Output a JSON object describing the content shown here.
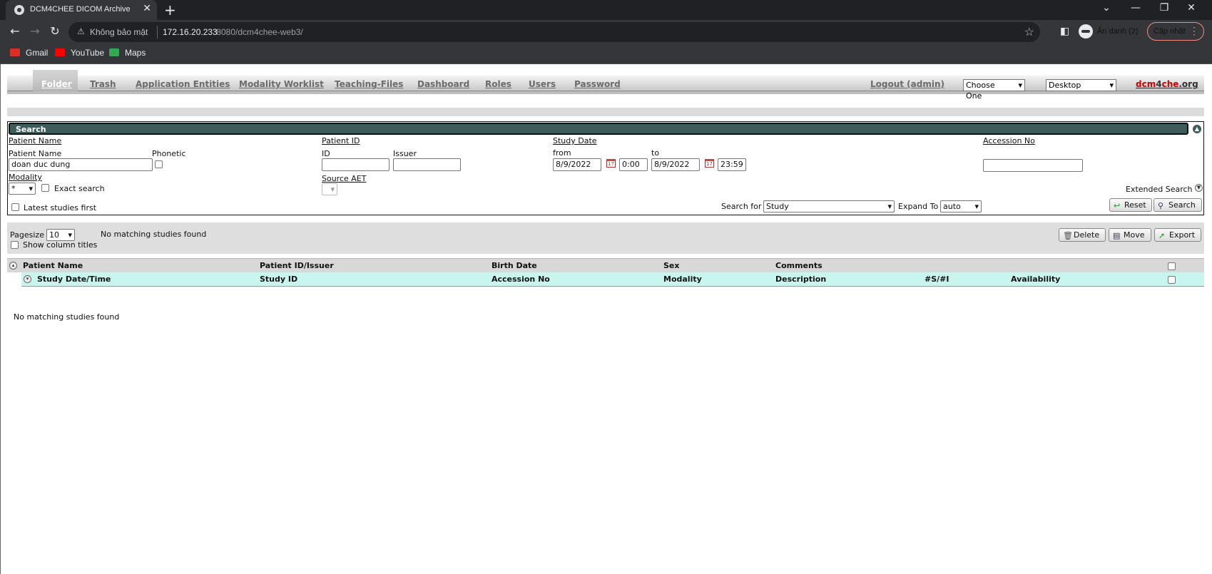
{
  "browser": {
    "tab_title": "DCM4CHEE DICOM Archive",
    "tab_close": "✕",
    "new_tab": "+",
    "window_controls": [
      "⌄",
      "—",
      "❐",
      "✕"
    ],
    "security_label": "Không bảo mật",
    "url_host": "172.16.20.233",
    "url_path": ":8080/dcm4chee-web3/",
    "incognito_label": "Ẩn danh (2)",
    "update_label": "Cập nhật",
    "bookmarks": [
      {
        "label": "Gmail",
        "color": "#d93025"
      },
      {
        "label": "YouTube",
        "color": "#ff0000"
      },
      {
        "label": "Maps",
        "color": "#34a853"
      }
    ]
  },
  "nav": {
    "items": [
      "Folder",
      "Trash",
      "Application Entities",
      "Modality Worklist",
      "Teaching-Files",
      "Dashboard",
      "Roles",
      "Users",
      "Password"
    ],
    "active": "Folder",
    "logout": "Logout (admin)",
    "choose_one": "Choose One",
    "desktop": "Desktop",
    "logo_parts": [
      "dcm",
      "4",
      "che",
      ".org"
    ]
  },
  "search": {
    "header": "Search",
    "patient_name_group": "Patient Name",
    "patient_name_label": "Patient Name",
    "patient_name_value": "doan duc dung",
    "phonetic_label": "Phonetic",
    "patient_id_group": "Patient ID",
    "id_label": "ID",
    "issuer_label": "Issuer",
    "study_date_group": "Study Date",
    "from_label": "from",
    "to_label": "to",
    "from_date": "8/9/2022",
    "from_time": "0:00",
    "to_date": "8/9/2022",
    "to_time": "23:59",
    "accession_label": "Accession No",
    "modality_label": "Modality",
    "modality_value": "*",
    "exact_search_label": "Exact search",
    "source_aet_label": "Source AET",
    "extended_search_label": "Extended Search",
    "latest_first_label": "Latest studies first",
    "search_for_label": "Search for",
    "search_for_value": "Study",
    "expand_to_label": "Expand To",
    "expand_to_value": "auto",
    "reset_button": "Reset",
    "search_button": "Search"
  },
  "results": {
    "pagesize_label": "Pagesize",
    "pagesize_value": "10",
    "status": "No matching studies found",
    "delete_button": "Delete",
    "move_button": "Move",
    "export_button": "Export",
    "show_column_titles": "Show column titles",
    "columns_patient": [
      "Patient Name",
      "Patient ID/Issuer",
      "Birth Date",
      "Sex",
      "Comments"
    ],
    "columns_study": [
      "Study Date/Time",
      "Study ID",
      "Accession No",
      "Modality",
      "Description",
      "#S/#I",
      "Availability"
    ],
    "empty_message": "No matching studies found"
  }
}
